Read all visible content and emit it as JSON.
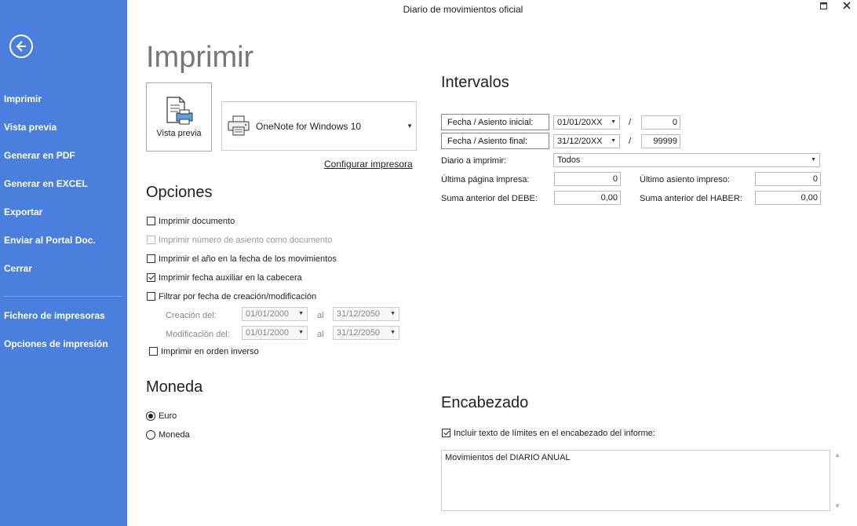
{
  "window": {
    "title": "Diario de movimientos oficial",
    "maximize_icon": "maximize-icon",
    "close_icon": "close-icon"
  },
  "sidebar": {
    "bg_color": "#4a7fdd",
    "back_icon": "back-arrow-icon",
    "items": [
      "Imprimir",
      "Vista previa",
      "Generar en PDF",
      "Generar en EXCEL",
      "Exportar",
      "Enviar al Portal Doc.",
      "Cerrar",
      "Fichero de impresoras",
      "Opciones de impresión"
    ]
  },
  "page_title": "Imprimir",
  "preview_button": {
    "label": "Vista previa",
    "icon": "print-preview-icon"
  },
  "printer": {
    "name": "OneNote for Windows 10",
    "icon": "printer-icon"
  },
  "configure_link": "Configurar impresora",
  "options": {
    "heading": "Opciones",
    "items": [
      {
        "label": "Imprimir documento",
        "checked": false,
        "disabled": false
      },
      {
        "label": "Imprimir número de asiento como documento",
        "checked": false,
        "disabled": true
      },
      {
        "label": "Imprimir el año en la fecha de los movimientos",
        "checked": false,
        "disabled": false
      },
      {
        "label": "Imprimir fecha auxiliar en la cabecera",
        "checked": true,
        "disabled": false
      },
      {
        "label": "Filtrar por fecha de creación/modificación",
        "checked": false,
        "disabled": false
      }
    ],
    "creation_label": "Creación del:",
    "creation_from": "01/01/2000",
    "creation_to": "31/12/2050",
    "modification_label": "Modificación del:",
    "modification_from": "01/01/2000",
    "modification_to": "31/12/2050",
    "al_label": "al",
    "reverse_order": {
      "label": "Imprimir en orden inverso",
      "checked": false
    }
  },
  "currency": {
    "heading": "Moneda",
    "options": [
      {
        "label": "Euro",
        "selected": true
      },
      {
        "label": "Moneda",
        "selected": false
      }
    ]
  },
  "intervals": {
    "heading": "Intervalos",
    "start_label": "Fecha / Asiento inicial:",
    "start_date": "01/01/20XX",
    "start_entry": "0",
    "end_label": "Fecha / Asiento final:",
    "end_date": "31/12/20XX",
    "end_entry": "99999",
    "slash": "/",
    "journal_label": "Diario a imprimir:",
    "journal_value": "Todos",
    "last_page_label": "Última página impresa:",
    "last_page_value": "0",
    "last_entry_label": "Último asiento impreso:",
    "last_entry_value": "0",
    "prev_debit_label": "Suma anterior del DEBE:",
    "prev_debit_value": "0,00",
    "prev_credit_label": "Suma anterior del HABER:",
    "prev_credit_value": "0,00"
  },
  "header": {
    "heading": "Encabezado",
    "include_label": "Incluir texto de límites en el encabezado del informe:",
    "include_checked": true,
    "text": "Movimientos del DIARIO ANUAL"
  }
}
